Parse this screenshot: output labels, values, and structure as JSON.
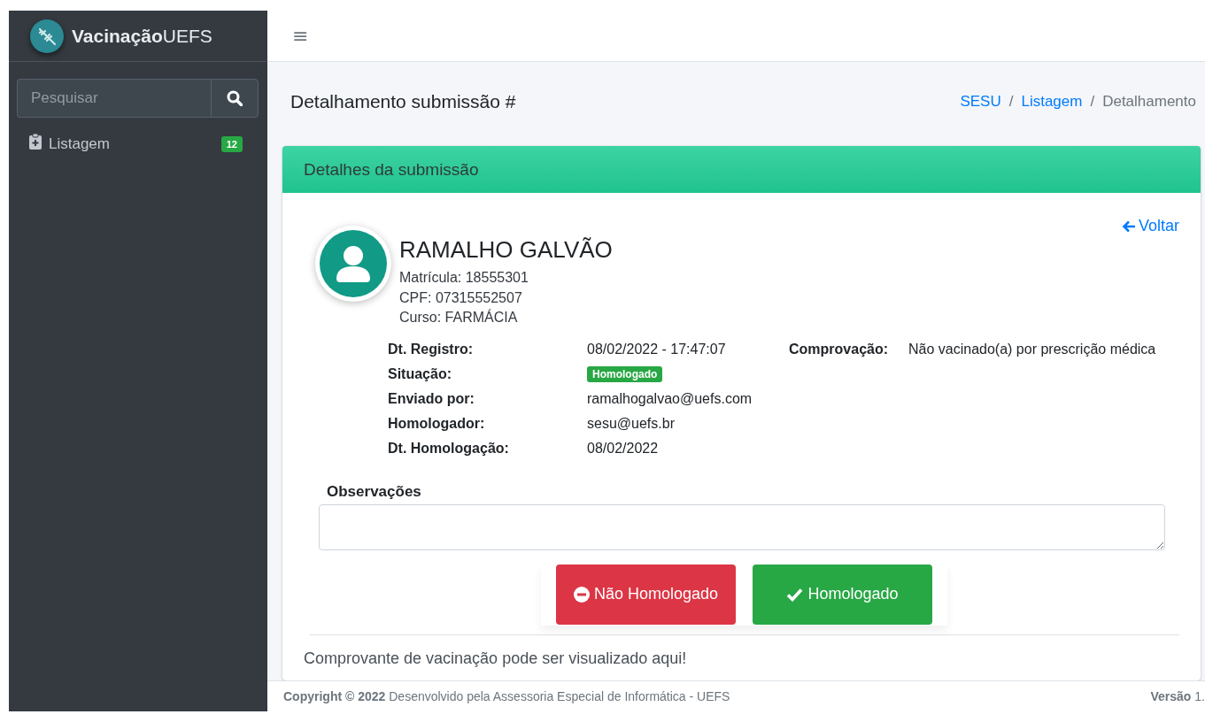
{
  "brand": {
    "name_bold": "Vacinação",
    "name_light": "UEFS"
  },
  "sidebar": {
    "search": {
      "placeholder": "Pesquisar"
    },
    "items": [
      {
        "label": "Listagem",
        "badge": "12",
        "selected": false
      }
    ]
  },
  "header": {
    "menu_icon": "≡"
  },
  "page": {
    "title": "Detalhamento submissão #",
    "breadcrumb": [
      {
        "label": "SESU",
        "link": true
      },
      {
        "label": "Listagem",
        "link": true
      },
      {
        "label": "Detalhamento",
        "link": false
      }
    ],
    "separator": "/"
  },
  "card": {
    "title": "Detalhes da submissão",
    "back_link": "Voltar",
    "person": {
      "name": "RAMALHO GALVÃO",
      "lines": [
        "Matrícula: 18555301",
        "CPF: 07315552507",
        "Curso: FARMÁCIA"
      ]
    },
    "details": [
      {
        "label": "Dt. Registro:",
        "value": "08/02/2022 - 17:47:07",
        "kind": "text"
      },
      {
        "label": "Situação:",
        "value": "Homologado",
        "kind": "badge",
        "color": "#28a745"
      },
      {
        "label": "Enviado por:",
        "value": "ramalhogalvao@uefs.com",
        "kind": "text"
      },
      {
        "label": "Homologador:",
        "value": "sesu@uefs.br",
        "kind": "text"
      },
      {
        "label": "Dt. Homologação:",
        "value": "08/02/2022",
        "kind": "text"
      }
    ],
    "side_detail": {
      "label": "Comprovação:",
      "value": "Não vacinado(a) por prescrição médica"
    },
    "notes": {
      "label": "Observações"
    },
    "buttons": [
      {
        "label": "Não Homologado",
        "kind": "reject"
      },
      {
        "label": "Homologado",
        "kind": "approve"
      }
    ],
    "footer_text": "Comprovante de vacinação pode ser visualizado aqui!"
  },
  "footer": {
    "text": "**Copyright © 2022** Desenvolvido pela Assessoria Especial de Informática - UEFS",
    "version": "**Versão** 1."
  }
}
